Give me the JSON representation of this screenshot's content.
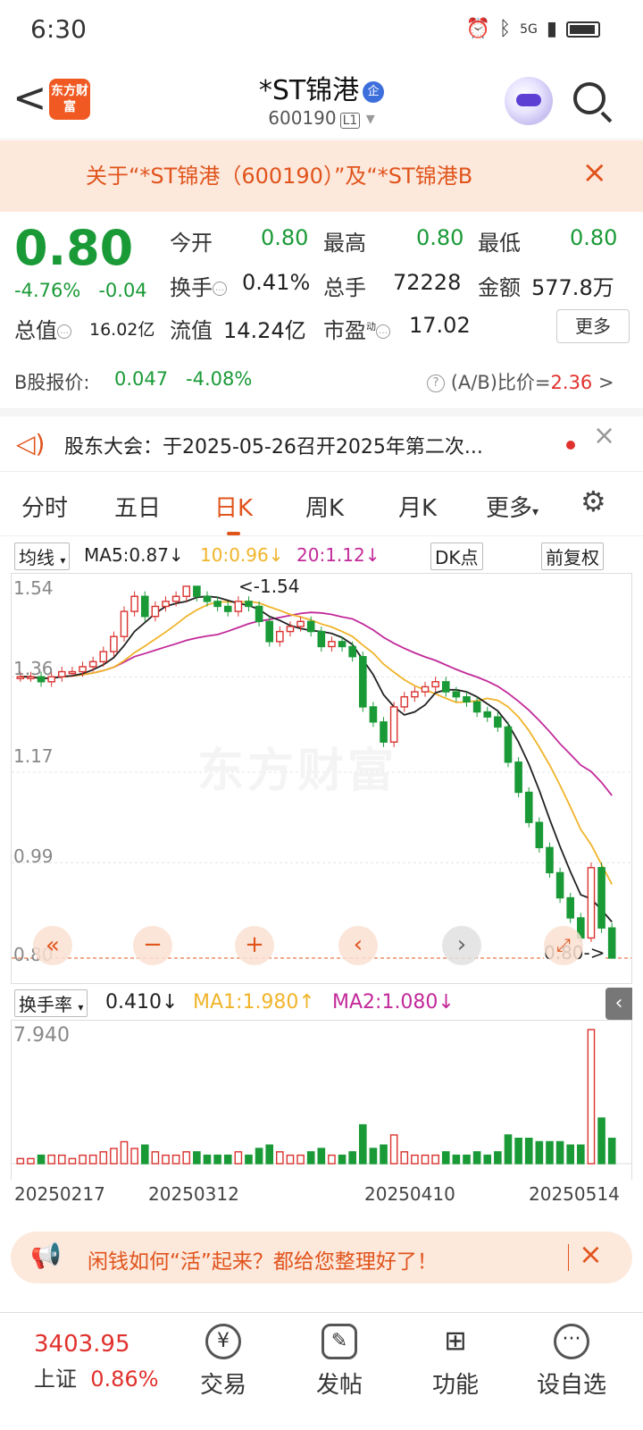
{
  "status": {
    "time": "6:30",
    "net": "5G"
  },
  "header": {
    "back": "<",
    "logo_text": "东方财富",
    "stock_name": "*ST锦港",
    "badge": "企",
    "code": "600190",
    "level": "L1"
  },
  "notice": {
    "text": "关于“*ST锦港（600190）”及“*ST锦港B",
    "close": "×"
  },
  "quote": {
    "price": "0.80",
    "change_pct": "-4.76%",
    "change": "-0.04",
    "open_label": "今开",
    "open": "0.80",
    "high_label": "最高",
    "high": "0.80",
    "low_label": "最低",
    "low": "0.80",
    "turnover_label": "换手",
    "turnover": "0.41%",
    "volume_label": "总手",
    "volume": "72228",
    "amount_label": "金额",
    "amount": "577.8万",
    "mktcap_label": "总值",
    "mktcap": "16.02亿",
    "float_label": "流值",
    "float": "14.24亿",
    "pe_label": "市盈",
    "pe_sup": "动",
    "pe": "17.02",
    "more": "更多"
  },
  "bshare": {
    "label": "B股报价:",
    "price": "0.047",
    "pct": "-4.08%",
    "ratio_label": "(A/B)比价=",
    "ratio": "2.36",
    "arrow": ">"
  },
  "meeting": {
    "text": "股东大会：于2025-05-26召开2025年第二次...",
    "close": "×"
  },
  "tabs": [
    "分时",
    "五日",
    "日K",
    "周K",
    "月K",
    "更多"
  ],
  "active_tab": 2,
  "ma_legend": {
    "selector": "均线",
    "ma5": "MA5:0.87↓",
    "ma10": "10:0.96↓",
    "ma20": "20:1.12↓",
    "dk": "DK点",
    "adjust": "前复权"
  },
  "vol_legend": {
    "selector": "换手率",
    "val": "0.410↓",
    "ma1": "MA1:1.980↑",
    "ma2": "MA2:1.080↓"
  },
  "chart_data": {
    "type": "candlestick",
    "y_ticks": [
      "1.54",
      "1.36",
      "1.17",
      "0.99",
      "0.80"
    ],
    "ylim": [
      0.8,
      1.54
    ],
    "max_label": "<-1.54",
    "last_label": "0.80->",
    "watermark": "东方财富",
    "x_labels": [
      "20250217",
      "20250312",
      "20250410",
      "20250514"
    ],
    "vol_ticks": [
      "7.940"
    ],
    "colors": {
      "up": "#d9322e",
      "down": "#1a9a37",
      "ma5": "#222222",
      "ma10": "#f0b42a",
      "ma20": "#c22a9a"
    },
    "closes": [
      1.36,
      1.36,
      1.35,
      1.36,
      1.37,
      1.37,
      1.38,
      1.39,
      1.41,
      1.44,
      1.49,
      1.52,
      1.48,
      1.5,
      1.51,
      1.52,
      1.54,
      1.52,
      1.51,
      1.5,
      1.49,
      1.51,
      1.5,
      1.47,
      1.43,
      1.45,
      1.46,
      1.47,
      1.45,
      1.42,
      1.43,
      1.42,
      1.4,
      1.3,
      1.27,
      1.23,
      1.3,
      1.32,
      1.33,
      1.34,
      1.35,
      1.33,
      1.32,
      1.31,
      1.29,
      1.28,
      1.26,
      1.19,
      1.13,
      1.07,
      1.02,
      0.97,
      0.92,
      0.88,
      0.84,
      0.98,
      0.86,
      0.8
    ]
  },
  "promo": {
    "text": "闲钱如何“活”起来？都给您整理好了！",
    "close": "×"
  },
  "nav": {
    "index_value": "3403.95",
    "index_name": "上证",
    "index_pct": "0.86%",
    "items": [
      "交易",
      "发帖",
      "功能",
      "设自选"
    ]
  }
}
